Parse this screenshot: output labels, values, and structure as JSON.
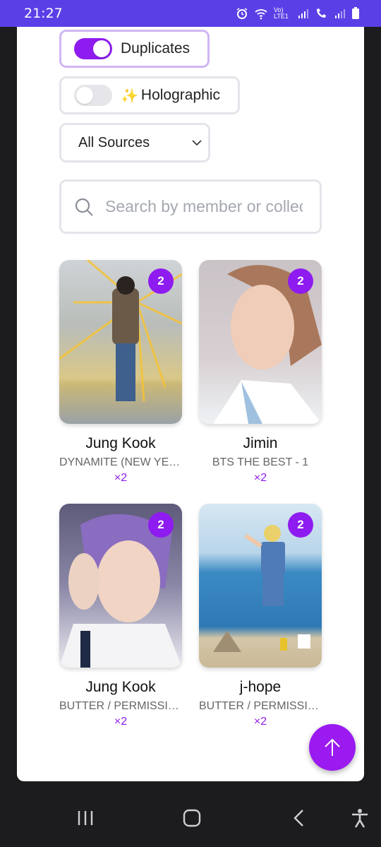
{
  "status_bar": {
    "time": "21:27",
    "icons": [
      "alarm-icon",
      "wifi-icon",
      "volte-icon",
      "signal-icon",
      "call-wifi-icon",
      "signal-icon",
      "battery-icon"
    ],
    "volte_label": "Vo) LTE1"
  },
  "filters": {
    "duplicates": {
      "label": "Duplicates",
      "on": true
    },
    "holographic": {
      "label": "Holographic",
      "icon": "sparkles-icon",
      "on": false
    },
    "source_select": {
      "value": "All Sources"
    },
    "search": {
      "placeholder": "Search by member or collection"
    }
  },
  "cards": [
    {
      "name": "Jung Kook",
      "collection": "DYNAMITE (NEW YEAR'S EVE)",
      "count_badge": "2",
      "count_label": "×2",
      "holographic": true
    },
    {
      "name": "Jimin",
      "collection": "BTS THE BEST - 1",
      "count_badge": "2",
      "count_label": "×2",
      "holographic": false
    },
    {
      "name": "Jung Kook",
      "collection": "BUTTER / PERMISSION TO DANCE",
      "count_badge": "2",
      "count_label": "×2",
      "holographic": false
    },
    {
      "name": "j-hope",
      "collection": "BUTTER / PERMISSION TO DANCE",
      "count_badge": "2",
      "count_label": "×2",
      "holographic": false
    }
  ],
  "fab": {
    "icon": "arrow-up-icon"
  },
  "nav": {
    "icons": [
      "recent-apps-icon",
      "home-icon",
      "back-icon",
      "accessibility-icon"
    ]
  },
  "colors": {
    "accent": "#8e1bef",
    "status_bar": "#5b3fe6"
  }
}
